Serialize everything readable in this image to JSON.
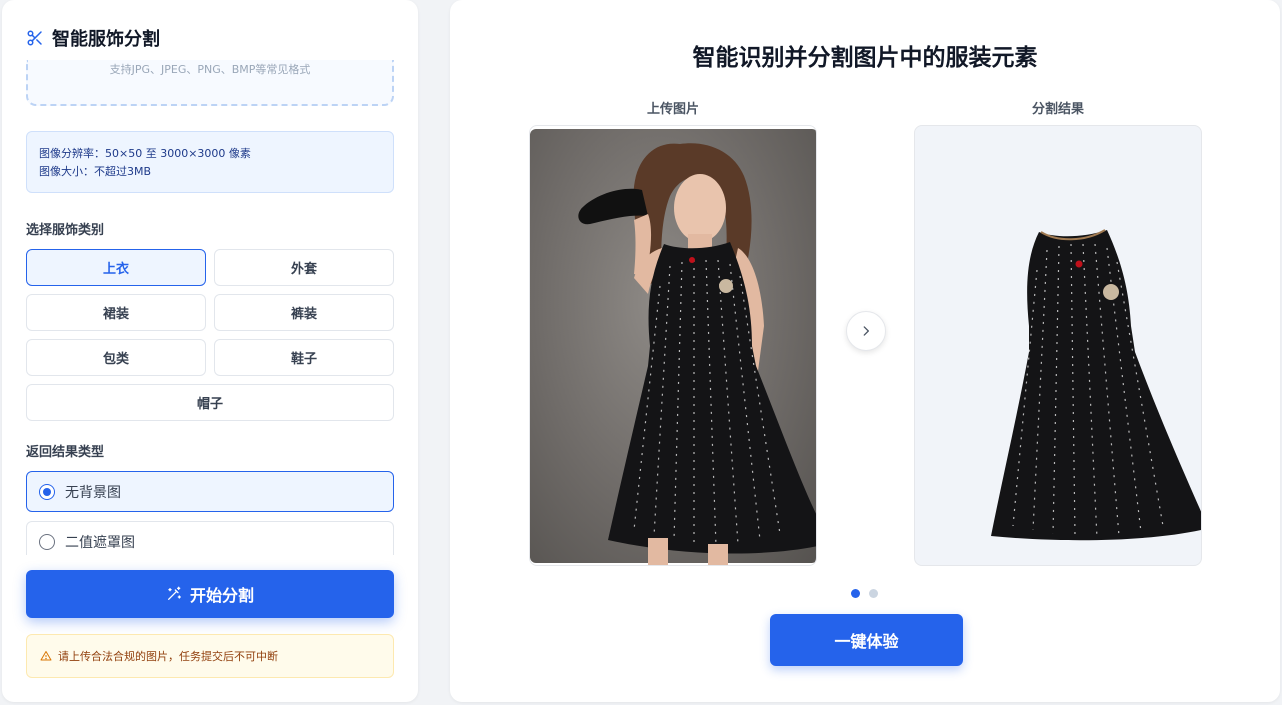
{
  "colors": {
    "accent": "#2563eb",
    "warning_bg": "#fffbeb",
    "warning_text": "#92400e",
    "info_bg": "#eef5ff"
  },
  "sidebar": {
    "app_icon": "scissors-icon",
    "title": "智能服饰分割",
    "upload_hint": "支持JPG、JPEG、PNG、BMP等常见格式",
    "info_lines": [
      "图像分辨率：50×50 至 3000×3000 像素",
      "图像大小：不超过3MB"
    ],
    "category_label": "选择服饰类别",
    "categories": [
      "上衣",
      "外套",
      "裙装",
      "裤装",
      "包类",
      "鞋子",
      "帽子"
    ],
    "selected_category": "上衣",
    "result_label": "返回结果类型",
    "result_options": [
      "无背景图",
      "二值遮罩图"
    ],
    "selected_result": "无背景图",
    "start_button": "开始分割",
    "start_icon": "magic-wand-icon",
    "warning_icon": "warning-icon",
    "warning_text": "请上传合法合规的图片，任务提交后不可中断"
  },
  "main": {
    "title": "智能识别并分割图片中的服装元素",
    "upload_label": "上传图片",
    "result_label": "分割结果",
    "next_icon": "chevron-right-icon",
    "carousel_pages": 2,
    "carousel_active": 1,
    "try_button": "一键体验"
  }
}
